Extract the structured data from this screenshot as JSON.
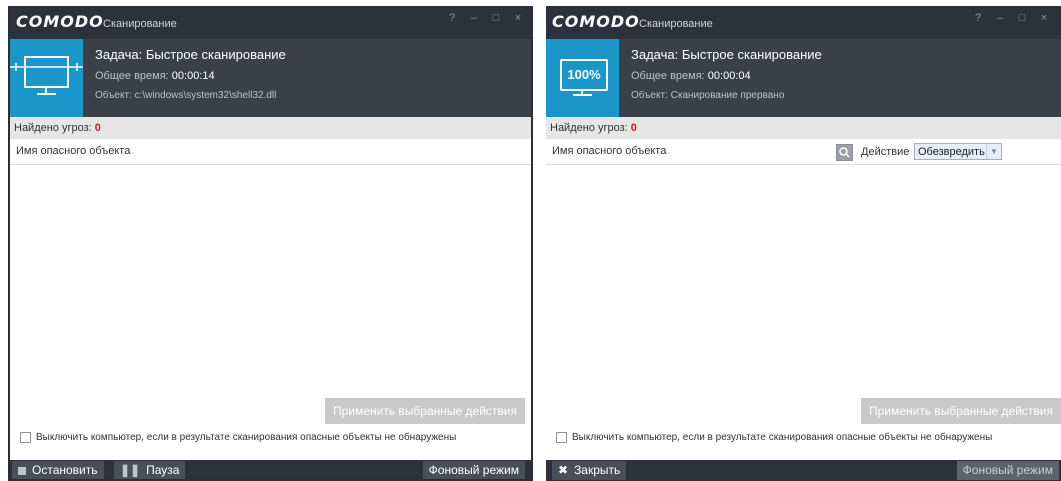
{
  "left": {
    "logo": "COMODO",
    "title": "Сканирование",
    "controls": [
      "?",
      "–",
      "□",
      "×"
    ],
    "task": "Задача: Быстрое сканирование",
    "time_label": "Общее время:",
    "time_value": "00:00:14",
    "object_label": "Объект:",
    "object_value": "c:\\windows\\system32\\shell32.dll",
    "threats_label": "Найдено угроз:",
    "threats_count": "0",
    "column_header": "Имя опасного объекта",
    "apply_button": "Применить выбранные действия",
    "shutdown_label": "Выключить компьютер, если в результате сканирования опасные объекты не обнаружены",
    "stop_button": "Остановить",
    "pause_button": "Пауза",
    "background_button": "Фоновый режим"
  },
  "right": {
    "logo": "COMODO",
    "title": "Сканирование",
    "controls": [
      "?",
      "–",
      "□",
      "×"
    ],
    "percent": "100%",
    "task": "Задача: Быстрое сканирование",
    "time_label": "Общее время:",
    "time_value": "00:00:04",
    "object_label": "Объект:",
    "object_value": "Сканирование прервано",
    "threats_label": "Найдено угроз:",
    "threats_count": "0",
    "column_header": "Имя опасного объекта",
    "action_label": "Действие",
    "action_value": "Обезвредить",
    "apply_button": "Применить выбранные действия",
    "shutdown_label": "Выключить компьютер, если в результате сканирования опасные объекты не обнаружены",
    "close_button": "Закрыть",
    "background_button": "Фоновый режим"
  },
  "icons": {
    "monitor": "monitor-icon",
    "search": "search-icon",
    "stop": "stop-icon",
    "pause": "pause-icon",
    "close": "close-icon"
  },
  "colors": {
    "titlebar": "#2d3139",
    "header": "#3b4048",
    "accent": "#1a96c8",
    "threat_count": "#cc1f1f",
    "apply_disabled": "#c9c9c9"
  }
}
